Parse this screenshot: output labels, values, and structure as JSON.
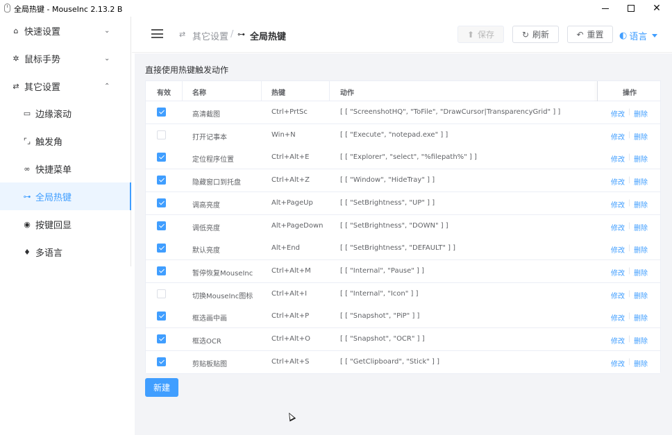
{
  "window": {
    "title": "全局热键 - MouseInc 2.13.2 B",
    "minimize_icon": "minimize-icon",
    "maximize_icon": "maximize-icon",
    "close_icon": "close-icon",
    "close_label": "✕"
  },
  "sidebar": {
    "items": [
      {
        "label": "快速设置",
        "icon": "home-icon",
        "glyph": "⌂",
        "chevron": "⌄"
      },
      {
        "label": "鼠标手势",
        "icon": "gear-icon",
        "glyph": "✲",
        "chevron": "⌄"
      },
      {
        "label": "其它设置",
        "icon": "sliders-icon",
        "glyph": "⇄",
        "chevron": "⌃"
      },
      {
        "label": "边缘滚动",
        "icon": "monitor-icon",
        "glyph": "▭"
      },
      {
        "label": "触发角",
        "icon": "corners-icon",
        "glyph": "⌜⌟"
      },
      {
        "label": "快捷菜单",
        "icon": "link-icon",
        "glyph": "∞"
      },
      {
        "label": "全局热键",
        "icon": "key-icon",
        "glyph": "⊶"
      },
      {
        "label": "按键回显",
        "icon": "eye-icon",
        "glyph": "◉"
      },
      {
        "label": "多语言",
        "icon": "mic-icon",
        "glyph": "♦"
      }
    ],
    "active_index": 6
  },
  "header": {
    "breadcrumb": [
      {
        "label": "其它设置",
        "icon": "sliders-icon",
        "glyph": "⇄"
      },
      {
        "label": "全局热键",
        "icon": "key-icon",
        "glyph": "⊶"
      }
    ],
    "breadcrumb_separator": "/",
    "save_label": "保存",
    "save_glyph": "⬆",
    "refresh_label": "刷新",
    "refresh_glyph": "↻",
    "reset_label": "重置",
    "reset_glyph": "↶",
    "language_label": "语言",
    "language_glyph": "◐"
  },
  "main": {
    "section_title": "直接使用热键触发动作",
    "columns": [
      "有效",
      "名称",
      "热键",
      "动作",
      "操作"
    ],
    "rows": [
      {
        "enabled": true,
        "name": "高清截图",
        "hotkey": "Ctrl+PrtSc",
        "action": "[ [ \"ScreenshotHQ\", \"ToFile\", \"DrawCursor|TransparencyGrid\" ] ]"
      },
      {
        "enabled": false,
        "name": "打开记事本",
        "hotkey": "Win+N",
        "action": "[ [ \"Execute\", \"notepad.exe\" ] ]"
      },
      {
        "enabled": true,
        "name": "定位程序位置",
        "hotkey": "Ctrl+Alt+E",
        "action": "[ [ \"Explorer\", \"select\", \"%filepath%\" ] ]"
      },
      {
        "enabled": true,
        "name": "隐藏窗口到托盘",
        "hotkey": "Ctrl+Alt+Z",
        "action": "[ [ \"Window\", \"HideTray\" ] ]"
      },
      {
        "enabled": true,
        "name": "调高亮度",
        "hotkey": "Alt+PageUp",
        "action": "[ [ \"SetBrightness\", \"UP\" ] ]"
      },
      {
        "enabled": true,
        "name": "调低亮度",
        "hotkey": "Alt+PageDown",
        "action": "[ [ \"SetBrightness\", \"DOWN\" ] ]"
      },
      {
        "enabled": true,
        "name": "默认亮度",
        "hotkey": "Alt+End",
        "action": "[ [ \"SetBrightness\", \"DEFAULT\" ] ]"
      },
      {
        "enabled": true,
        "name": "暂停恢复MouseInc",
        "hotkey": "Ctrl+Alt+M",
        "action": "[ [ \"Internal\", \"Pause\" ] ]"
      },
      {
        "enabled": false,
        "name": "切换MouseInc图标",
        "hotkey": "Ctrl+Alt+I",
        "action": "[ [ \"Internal\", \"Icon\" ] ]"
      },
      {
        "enabled": true,
        "name": "框选画中画",
        "hotkey": "Ctrl+Alt+P",
        "action": "[ [ \"Snapshot\", \"PiP\" ] ]"
      },
      {
        "enabled": true,
        "name": "框选OCR",
        "hotkey": "Ctrl+Alt+O",
        "action": "[ [ \"Snapshot\", \"OCR\" ] ]"
      },
      {
        "enabled": true,
        "name": "剪贴板贴图",
        "hotkey": "Ctrl+Alt+S",
        "action": "[ [ \"GetClipboard\", \"Stick\" ] ]"
      }
    ],
    "edit_label": "修改",
    "delete_label": "删除",
    "op_separator": "|",
    "new_label": "新建"
  },
  "colors": {
    "accent": "#409eff",
    "background": "#f3f4f7",
    "text": "#303133"
  }
}
